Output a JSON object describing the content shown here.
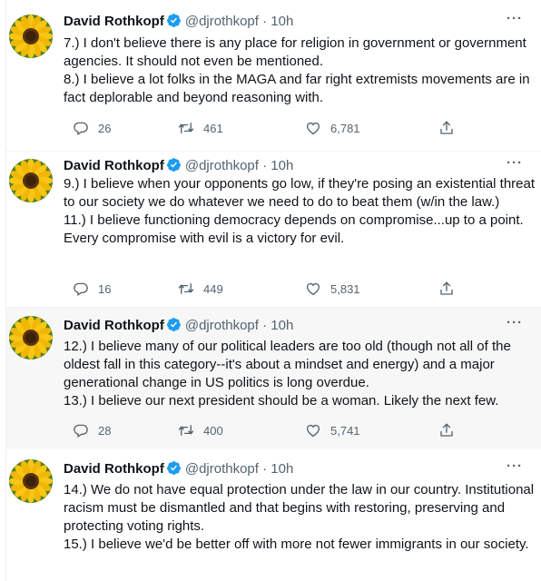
{
  "author": {
    "name": "David Rothkopf",
    "handle": "@djrothkopf",
    "separator": "·",
    "age": "10h"
  },
  "colors": {
    "verified": "#1d9bf0",
    "muted": "#536471",
    "hover_bg": "#f7f7f7"
  },
  "tweets": [
    {
      "text": "7.) I don't believe there is any place for religion in government or government agencies. It should not even be mentioned.\n8.) I believe a lot folks in the MAGA and far right extremists movements are in fact deplorable and beyond reasoning with.",
      "replies": "26",
      "retweets": "461",
      "likes": "6,781"
    },
    {
      "text": "9.) I believe when your opponents go low, if they're posing an existential threat to our society we do whatever we need to do to beat them (w/in the law.)\n11.) I believe functioning democracy depends on compromise...up to a point. Every compromise with evil is a victory for evil.",
      "replies": "16",
      "retweets": "449",
      "likes": "5,831"
    },
    {
      "text": "12.) I believe many of our political leaders are too old (though not all of the oldest fall in this category--it's about a mindset and energy) and a major generational change in US politics is long overdue.\n13.) I believe our next president should be a woman. Likely the next few.",
      "replies": "28",
      "retweets": "400",
      "likes": "5,741"
    },
    {
      "text": "14.) We do not have equal protection under the law in our country. Institutional racism must be dismantled and that begins with restoring, preserving and protecting voting rights.\n15.) I believe we'd be better off with more not fewer immigrants in our society."
    }
  ],
  "icons": {
    "avatar": "sunflower-avatar",
    "verified": "verified-badge-icon",
    "more": "more-icon",
    "reply": "reply-icon",
    "retweet": "retweet-icon",
    "like": "like-icon",
    "share": "share-icon"
  }
}
